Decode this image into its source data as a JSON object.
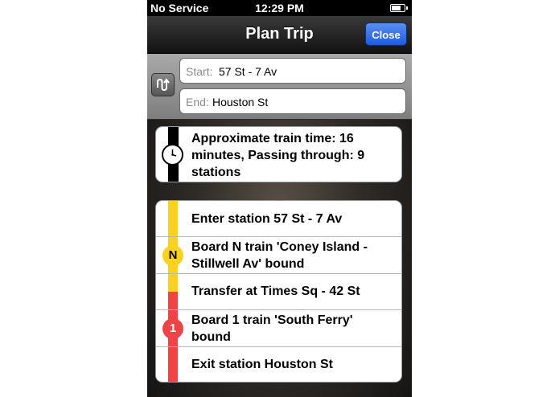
{
  "status_bar": {
    "carrier": "No Service",
    "time": "12:29 PM",
    "battery_level": 0.75
  },
  "nav": {
    "title": "Plan Trip",
    "close_label": "Close"
  },
  "route": {
    "start_label": "Start:",
    "start_value": "57 St - 7 Av",
    "end_label": "End:",
    "end_value": "Houston St"
  },
  "summary": {
    "text": "Approximate train time: 16 minutes, Passing through: 9 stations"
  },
  "steps": [
    {
      "text": "Enter station 57 St - 7 Av"
    },
    {
      "text": "Board N train 'Coney Island - Stillwell Av' bound"
    },
    {
      "text": "Transfer at Times Sq - 42 St"
    },
    {
      "text": "Board 1 train 'South Ferry' bound"
    },
    {
      "text": "Exit station Houston St"
    }
  ],
  "lines": [
    {
      "name": "N",
      "color": "#fcd21f",
      "text_color": "#000000"
    },
    {
      "name": "1",
      "color": "#ee4448",
      "text_color": "#ffffff"
    }
  ],
  "colors": {
    "accent": "#1c5be0"
  }
}
